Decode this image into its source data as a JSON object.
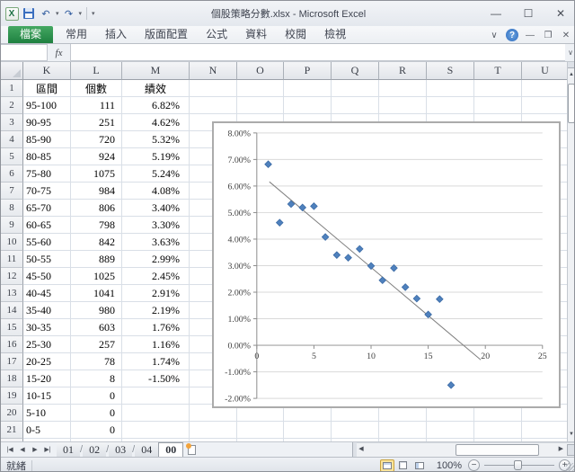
{
  "window": {
    "title": "個股策略分數.xlsx - Microsoft Excel"
  },
  "icons": {
    "excel_logo": "X",
    "undo": "↶",
    "redo": "↷",
    "dropdown": "▾",
    "win_min": "—",
    "win_max": "☐",
    "win_close": "✕",
    "ribbon_collapse": "∨",
    "help": "?",
    "wb_min": "—",
    "wb_restore": "❐",
    "wb_close": "✕",
    "formula_expand": "∨",
    "fx": "fx",
    "scroll_up": "▲",
    "scroll_down": "▼",
    "scroll_left": "◀",
    "scroll_right": "▶",
    "tab_first": "|◀",
    "tab_prev": "◀",
    "tab_next": "▶",
    "tab_last": "▶|",
    "zoom_out": "−",
    "zoom_in": "+"
  },
  "ribbon": {
    "tabs": [
      {
        "id": "file",
        "label": "檔案"
      },
      {
        "id": "home",
        "label": "常用"
      },
      {
        "id": "insert",
        "label": "插入"
      },
      {
        "id": "page-layout",
        "label": "版面配置"
      },
      {
        "id": "formulas",
        "label": "公式"
      },
      {
        "id": "data",
        "label": "資料"
      },
      {
        "id": "review",
        "label": "校閱"
      },
      {
        "id": "view",
        "label": "檢視"
      }
    ]
  },
  "formula_bar": {
    "name_box_value": "",
    "formula_value": ""
  },
  "sheet": {
    "columns": [
      "K",
      "L",
      "M",
      "N",
      "O",
      "P",
      "Q",
      "R",
      "S",
      "T",
      "U"
    ],
    "rows": [
      {
        "n": 1,
        "c": [
          "區間",
          "個數",
          "績效"
        ]
      },
      {
        "n": 2,
        "c": [
          "95-100",
          "111",
          "6.82%"
        ]
      },
      {
        "n": 3,
        "c": [
          "90-95",
          "251",
          "4.62%"
        ]
      },
      {
        "n": 4,
        "c": [
          "85-90",
          "720",
          "5.32%"
        ]
      },
      {
        "n": 5,
        "c": [
          "80-85",
          "924",
          "5.19%"
        ]
      },
      {
        "n": 6,
        "c": [
          "75-80",
          "1075",
          "5.24%"
        ]
      },
      {
        "n": 7,
        "c": [
          "70-75",
          "984",
          "4.08%"
        ]
      },
      {
        "n": 8,
        "c": [
          "65-70",
          "806",
          "3.40%"
        ]
      },
      {
        "n": 9,
        "c": [
          "60-65",
          "798",
          "3.30%"
        ]
      },
      {
        "n": 10,
        "c": [
          "55-60",
          "842",
          "3.63%"
        ]
      },
      {
        "n": 11,
        "c": [
          "50-55",
          "889",
          "2.99%"
        ]
      },
      {
        "n": 12,
        "c": [
          "45-50",
          "1025",
          "2.45%"
        ]
      },
      {
        "n": 13,
        "c": [
          "40-45",
          "1041",
          "2.91%"
        ]
      },
      {
        "n": 14,
        "c": [
          "35-40",
          "980",
          "2.19%"
        ]
      },
      {
        "n": 15,
        "c": [
          "30-35",
          "603",
          "1.76%"
        ]
      },
      {
        "n": 16,
        "c": [
          "25-30",
          "257",
          "1.16%"
        ]
      },
      {
        "n": 17,
        "c": [
          "20-25",
          "78",
          "1.74%"
        ]
      },
      {
        "n": 18,
        "c": [
          "15-20",
          "8",
          "-1.50%"
        ]
      },
      {
        "n": 19,
        "c": [
          "10-15",
          "0",
          ""
        ]
      },
      {
        "n": 20,
        "c": [
          "5-10",
          "0",
          ""
        ]
      },
      {
        "n": 21,
        "c": [
          "0-5",
          "0",
          ""
        ]
      },
      {
        "n": 22,
        "c": [
          "",
          "",
          ""
        ]
      }
    ]
  },
  "chart_data": {
    "type": "scatter",
    "title": "",
    "xlabel": "",
    "ylabel": "",
    "legend": "none",
    "grid": "horizontal",
    "xlim": [
      0,
      25
    ],
    "ylim": [
      -2,
      8
    ],
    "y_unit": "%",
    "x_ticks": [
      0,
      5,
      10,
      15,
      20,
      25
    ],
    "x_tick_labels": [
      "0",
      "5",
      "10",
      "15",
      "20",
      "25"
    ],
    "y_ticks": [
      8,
      7,
      6,
      5,
      4,
      3,
      2,
      1,
      0,
      -1,
      -2
    ],
    "y_tick_labels": [
      "8.00%",
      "7.00%",
      "6.00%",
      "5.00%",
      "4.00%",
      "3.00%",
      "2.00%",
      "1.00%",
      "0.00%",
      "-1.00%",
      "-2.00%"
    ],
    "gridline_color": "#D9D9D9",
    "axis_color": "#8C8C8C",
    "series": [
      {
        "name": "績效",
        "marker": "diamond",
        "color": "#4F81BD",
        "points": [
          [
            1,
            6.82
          ],
          [
            2,
            4.62
          ],
          [
            3,
            5.32
          ],
          [
            4,
            5.19
          ],
          [
            5,
            5.24
          ],
          [
            6,
            4.08
          ],
          [
            7,
            3.4
          ],
          [
            8,
            3.3
          ],
          [
            9,
            3.63
          ],
          [
            10,
            2.99
          ],
          [
            11,
            2.45
          ],
          [
            12,
            2.91
          ],
          [
            13,
            2.19
          ],
          [
            14,
            1.76
          ],
          [
            15,
            1.16
          ],
          [
            16,
            1.74
          ],
          [
            17,
            -1.5
          ]
        ]
      }
    ],
    "trendline": {
      "x1": 1.1,
      "y1": 6.16,
      "x2": 19.6,
      "y2": -0.55,
      "color": "#7F7F7F"
    }
  },
  "sheet_tabs": {
    "tabs": [
      {
        "label": "01",
        "active": false
      },
      {
        "label": "02",
        "active": false
      },
      {
        "label": "03",
        "active": false
      },
      {
        "label": "04",
        "active": false
      },
      {
        "label": "00",
        "active": true
      }
    ]
  },
  "status_bar": {
    "ready": "就緒",
    "zoom": "100%"
  }
}
